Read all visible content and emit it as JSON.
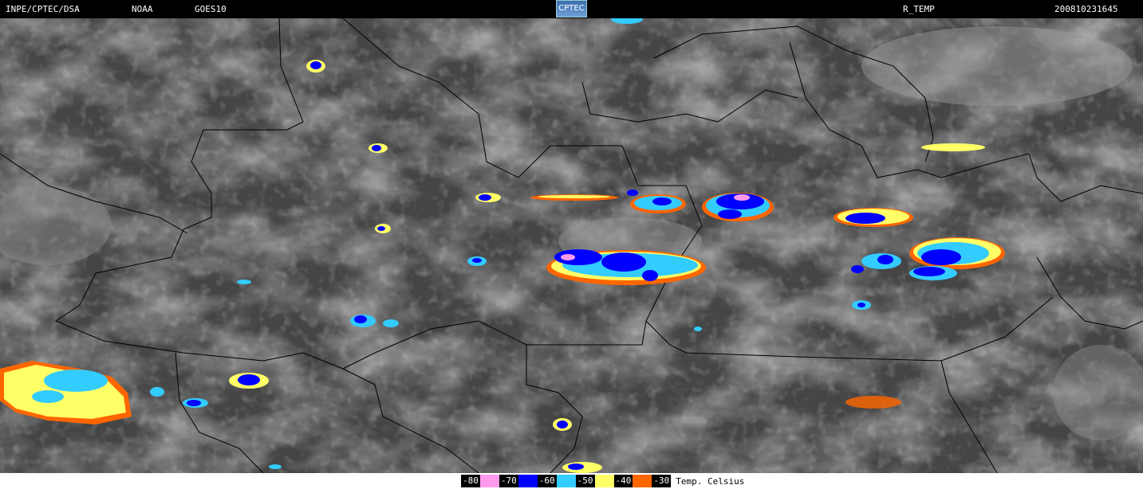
{
  "header": {
    "agency": "INPE/CPTEC/DSA",
    "source": "NOAA",
    "satellite": "GOES10",
    "logo_text": "CPTEC",
    "product": "R_TEMP",
    "timestamp": "200810231645"
  },
  "legend": {
    "unit_label": "Temp. Celsius",
    "steps": [
      {
        "value": "-80",
        "color": "#ff99ee"
      },
      {
        "value": "-70",
        "color": "#0000ff"
      },
      {
        "value": "-60",
        "color": "#33ccff"
      },
      {
        "value": "-50",
        "color": "#ffff66"
      },
      {
        "value": "-40",
        "color": "#ff6600"
      },
      {
        "value": "-30",
        "color": "#ff6600"
      }
    ]
  }
}
